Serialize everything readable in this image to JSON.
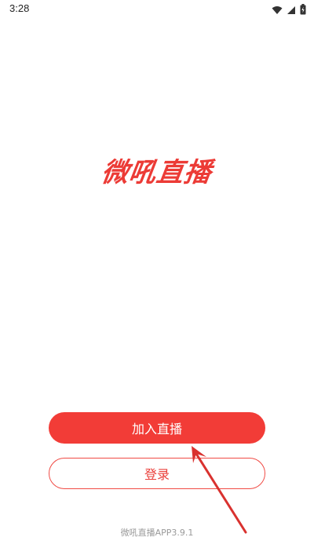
{
  "status_bar": {
    "time": "3:28",
    "icons": [
      "wifi-icon",
      "signal-icon",
      "battery-icon"
    ]
  },
  "app": {
    "logo_text": "微吼直播",
    "version": "微吼直播APP3.9.1"
  },
  "buttons": {
    "join_label": "加入直播",
    "login_label": "登录"
  },
  "annotation": {
    "icon": "red-arrow-icon"
  },
  "colors": {
    "brand_red": "#f23c37",
    "version_gray": "#9a9a9a"
  }
}
